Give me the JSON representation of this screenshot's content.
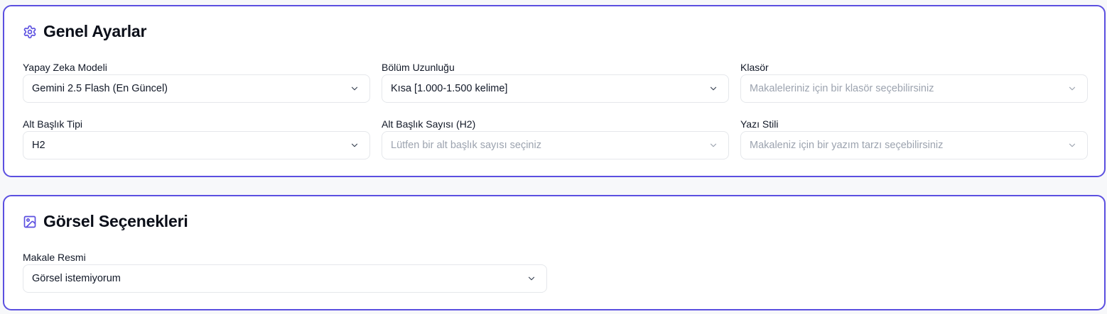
{
  "general": {
    "title": "Genel Ayarlar",
    "icon": "gear-icon",
    "fields": [
      {
        "label": "Yapay Zeka Modeli",
        "value": "Gemini 2.5 Flash (En Güncel)",
        "placeholder": ""
      },
      {
        "label": "Bölüm Uzunluğu",
        "value": "Kısa [1.000-1.500 kelime]",
        "placeholder": ""
      },
      {
        "label": "Klasör",
        "value": "",
        "placeholder": "Makaleleriniz için bir klasör seçebilirsiniz"
      },
      {
        "label": "Alt Başlık Tipi",
        "value": "H2",
        "placeholder": ""
      },
      {
        "label": "Alt Başlık Sayısı (H2)",
        "value": "",
        "placeholder": "Lütfen bir alt başlık sayısı seçiniz"
      },
      {
        "label": "Yazı Stili",
        "value": "",
        "placeholder": "Makaleniz için bir yazım tarzı seçebilirsiniz"
      }
    ]
  },
  "visual": {
    "title": "Görsel Seçenekleri",
    "icon": "image-icon",
    "fields": [
      {
        "label": "Makale Resmi",
        "value": "Görsel istemiyorum",
        "placeholder": ""
      }
    ]
  },
  "colors": {
    "accent": "#5b4fe0",
    "placeholder_text": "#9ca3af",
    "border": "#e5e7eb"
  }
}
